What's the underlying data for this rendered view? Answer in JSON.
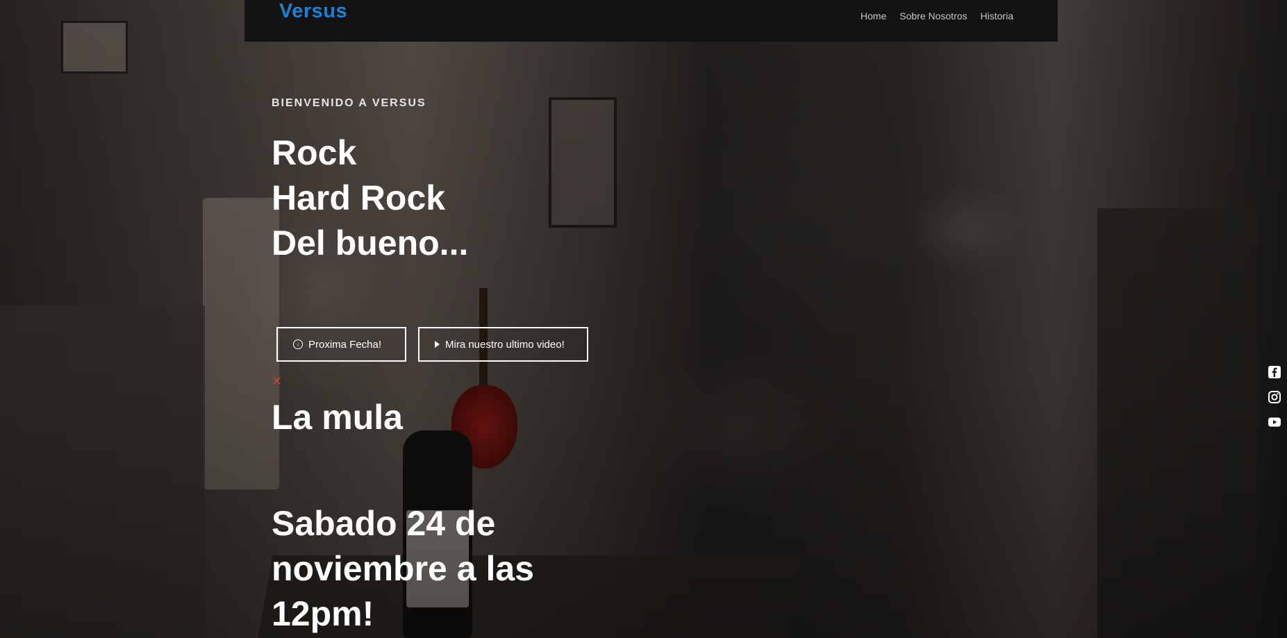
{
  "nav": {
    "brand": "Versus",
    "links": [
      "Home",
      "Sobre Nosotros",
      "Historia"
    ]
  },
  "hero": {
    "eyebrow": "BIENVENIDO A VERSUS",
    "headline": [
      "Rock",
      "Hard Rock",
      "Del bueno..."
    ],
    "buttons": {
      "next_date": "Proxima Fecha!",
      "latest_video": "Mira nuestro ultimo video!"
    },
    "close_symbol": "✕"
  },
  "event": {
    "title": "La mula",
    "date": "Sabado 24 de noviembre a las 12pm!"
  },
  "social": [
    "facebook-icon",
    "instagram-icon",
    "youtube-icon"
  ],
  "colors": {
    "brand": "#1a82d6",
    "navbar_bg": "#121212",
    "close": "#e23a2c",
    "text": "#ffffff"
  }
}
